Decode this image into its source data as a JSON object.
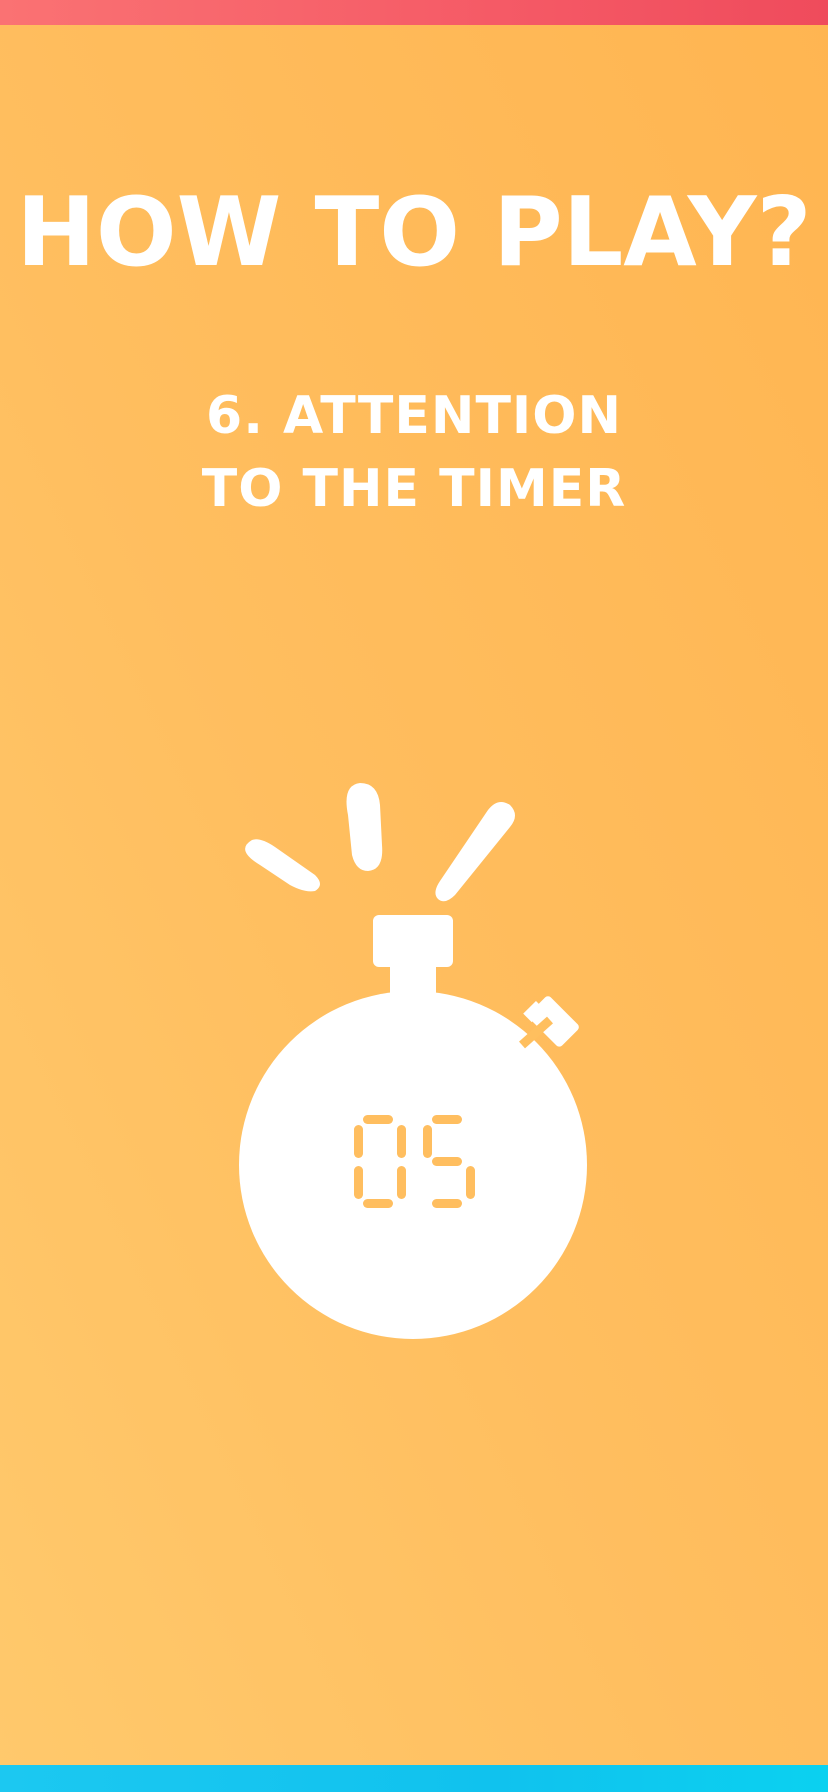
{
  "screen": {
    "title": "HOW TO PLAY?",
    "step_line1": "6. ATTENTION",
    "step_line2": "TO THE TIMER"
  },
  "timer": {
    "icon": "stopwatch-icon",
    "display_value": "05"
  },
  "colors": {
    "background": "#ffbe5f",
    "top_bar": "#f55a66",
    "bottom_bar": "#10c2ee",
    "text": "#ffffff",
    "timer_digits": "#ffbe5f"
  }
}
